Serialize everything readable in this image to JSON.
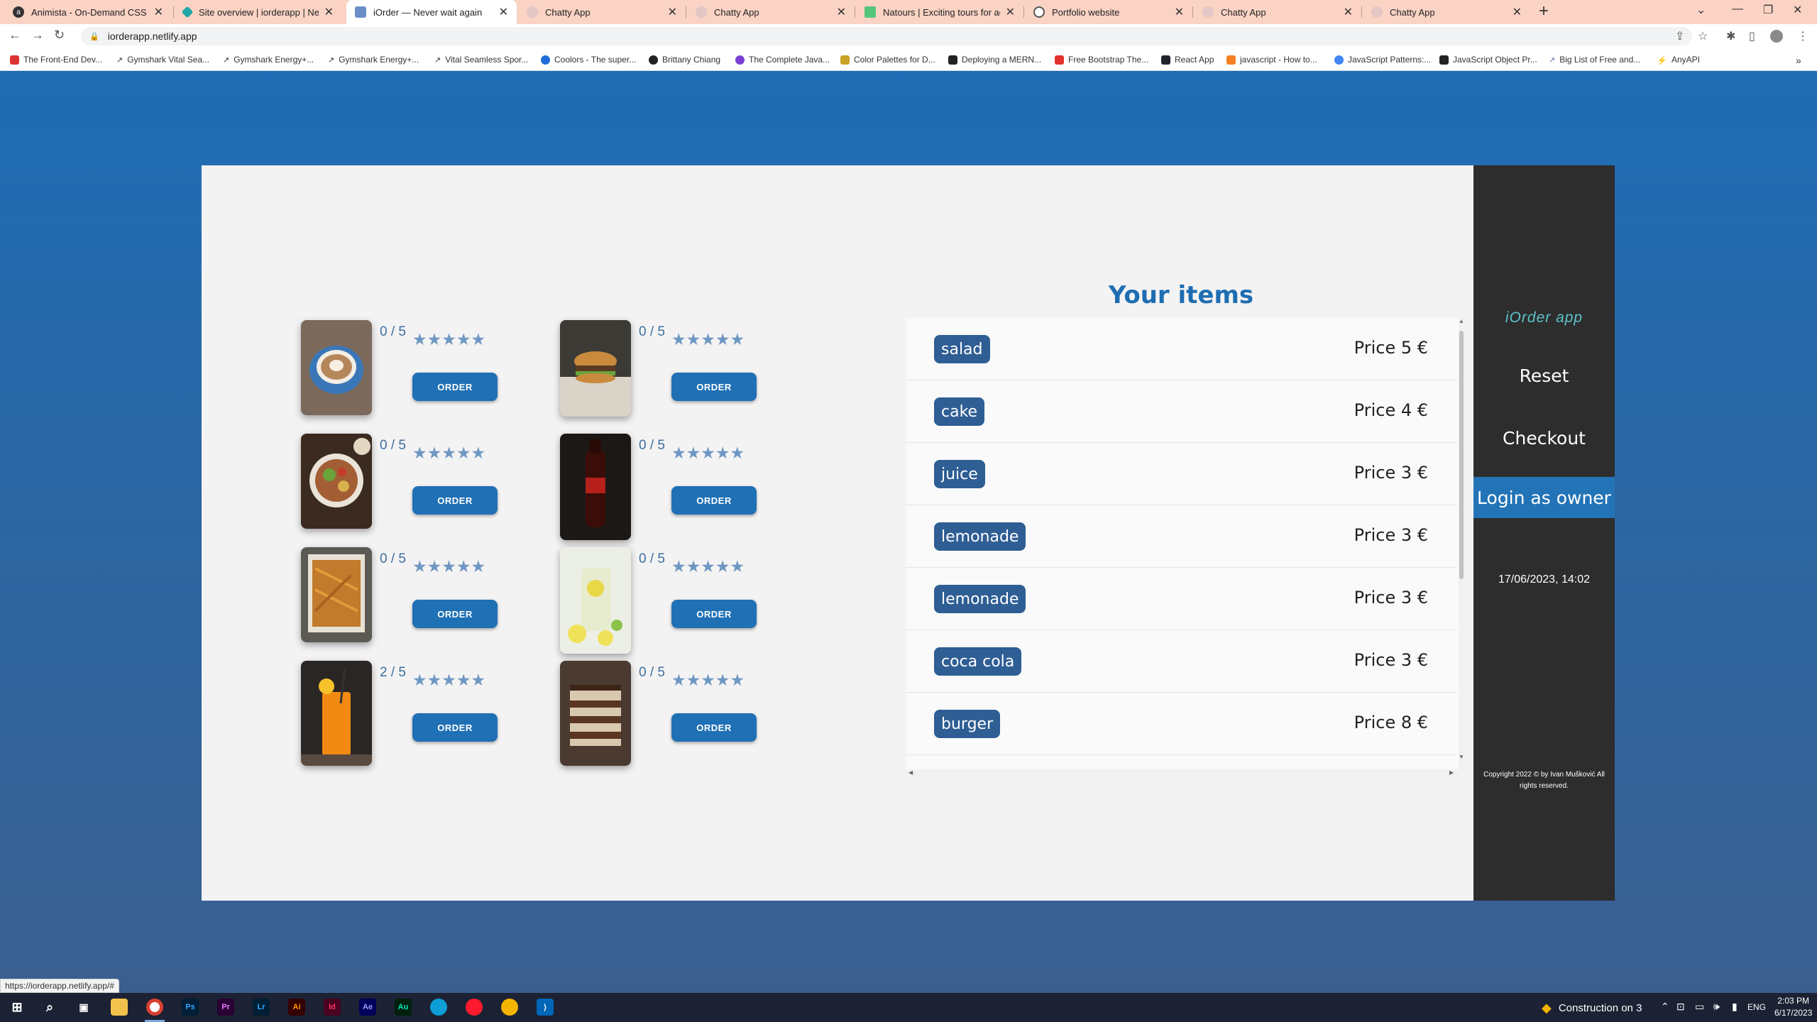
{
  "browser": {
    "tabs": [
      {
        "title": "Animista - On-Demand CSS Anim",
        "icon": "animista-icon",
        "color": "#333333"
      },
      {
        "title": "Site overview | iorderapp | Netlify",
        "icon": "netlify-icon",
        "color": "#20a7a5"
      },
      {
        "title": "iOrder — Never wait again",
        "icon": "iorder-icon",
        "color": "#6a8fc7"
      },
      {
        "title": "Chatty App",
        "icon": "globe-icon",
        "color": "#c9a8a8"
      },
      {
        "title": "Chatty App",
        "icon": "globe-icon",
        "color": "#c9a8a8"
      },
      {
        "title": "Natours | Exciting tours for adve",
        "icon": "natours-icon",
        "color": "#55c57a"
      },
      {
        "title": "Portfolio website",
        "icon": "globe-icon",
        "color": "#666666"
      },
      {
        "title": "Chatty App",
        "icon": "globe-icon",
        "color": "#c9a8a8"
      },
      {
        "title": "Chatty App",
        "icon": "globe-icon",
        "color": "#c9a8a8"
      }
    ],
    "url": "iorderapp.netlify.app",
    "bookmarks": [
      "The Front-End Dev...",
      "Gymshark Vital Sea...",
      "Gymshark Energy+...",
      "Gymshark Energy+...",
      "Vital Seamless Spor...",
      "Coolors - The super...",
      "Brittany Chiang",
      "The Complete Java...",
      "Color Palettes for D...",
      "Deploying a MERN...",
      "Free Bootstrap The...",
      "React App",
      "javascript - How to...",
      "JavaScript Patterns:...",
      "JavaScript Object Pr...",
      "Big List of Free and...",
      "AnyAPI"
    ],
    "status_url": "https://iorderapp.netlify.app/#"
  },
  "menu": {
    "items": [
      {
        "rating": "0 / 5",
        "stars": "★★★★★",
        "order_label": "ORDER",
        "image": "coffee-photo"
      },
      {
        "rating": "0 / 5",
        "stars": "★★★★★",
        "order_label": "ORDER",
        "image": "burger-photo"
      },
      {
        "rating": "0 / 5",
        "stars": "★★★★★",
        "order_label": "ORDER",
        "image": "salad-photo"
      },
      {
        "rating": "0 / 5",
        "stars": "★★★★★",
        "order_label": "ORDER",
        "image": "cola-photo"
      },
      {
        "rating": "0 / 5",
        "stars": "★★★★★",
        "order_label": "ORDER",
        "image": "fries-photo"
      },
      {
        "rating": "0 / 5",
        "stars": "★★★★★",
        "order_label": "ORDER",
        "image": "lemonade-photo"
      },
      {
        "rating": "2 / 5",
        "stars": "★★★★★",
        "order_label": "ORDER",
        "image": "juice-photo"
      },
      {
        "rating": "0 / 5",
        "stars": "★★★★★",
        "order_label": "ORDER",
        "image": "cake-photo"
      }
    ]
  },
  "cart": {
    "title": "Your items",
    "items": [
      {
        "name": "salad",
        "price": "Price 5 €"
      },
      {
        "name": "cake",
        "price": "Price 4 €"
      },
      {
        "name": "juice",
        "price": "Price 3 €"
      },
      {
        "name": "lemonade",
        "price": "Price 3 €"
      },
      {
        "name": "lemonade",
        "price": "Price 3 €"
      },
      {
        "name": "coca cola",
        "price": "Price 3 €"
      },
      {
        "name": "burger",
        "price": "Price 8 €"
      }
    ]
  },
  "sidebar": {
    "brand": "iOrder app",
    "reset_label": "Reset",
    "checkout_label": "Checkout",
    "login_label": "Login as owner",
    "datetime": "17/06/2023, 14:02",
    "copyright": "Copyright 2022 © by Ivan Mušković All rights reserved."
  },
  "taskbar": {
    "weather": "Construction on 3",
    "lang": "ENG",
    "time": "2:03 PM",
    "date": "6/17/2023"
  },
  "colors": {
    "accent": "#1f70b5",
    "pill": "#2e5e94",
    "sidebar": "#2d2d2d",
    "brand": "#5dc2c8"
  }
}
